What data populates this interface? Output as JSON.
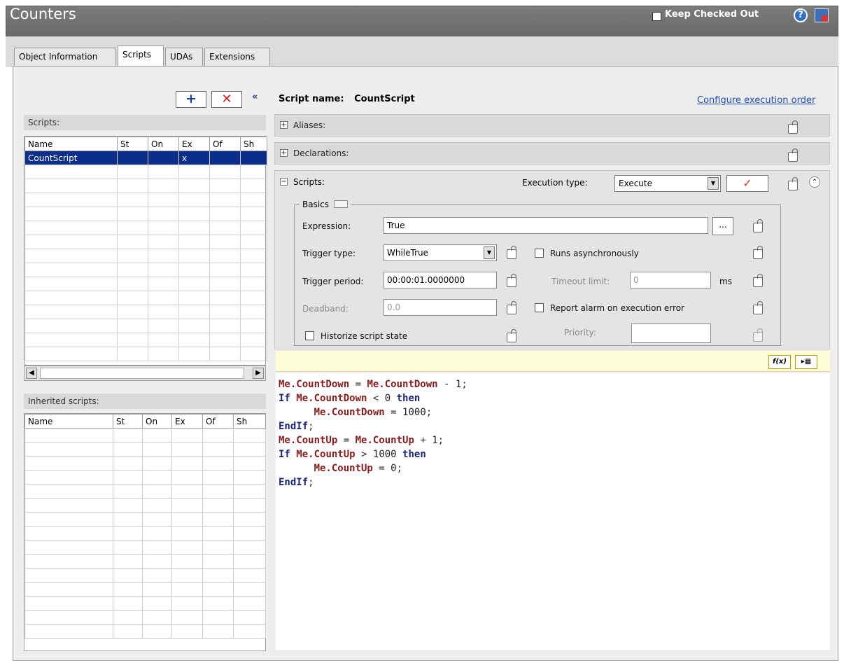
{
  "window": {
    "title": "Counters",
    "keep_checked_out_label": "Keep Checked Out",
    "help_icon": "?"
  },
  "tabs": [
    {
      "label": "Object Information",
      "active": false
    },
    {
      "label": "Scripts",
      "active": true
    },
    {
      "label": "UDAs",
      "active": false
    },
    {
      "label": "Extensions",
      "active": false
    }
  ],
  "left": {
    "add_glyph": "+",
    "delete_glyph": "✕",
    "collapse_glyph": "«",
    "scripts_label": "Scripts:",
    "inherited_label": "Inherited scripts:",
    "columns": [
      "Name",
      "St",
      "On",
      "Ex",
      "Of",
      "Sh"
    ],
    "scripts_rows": [
      {
        "name": "CountScript",
        "st": "",
        "on": "",
        "ex": "x",
        "of": "",
        "sh": "",
        "selected": true
      }
    ]
  },
  "right": {
    "script_name_label": "Script name:",
    "script_name": "CountScript",
    "configure_link": "Configure execution order",
    "sections": {
      "aliases": "Aliases:",
      "declarations": "Declarations:",
      "scripts": "Scripts:"
    },
    "execution_type_label": "Execution type:",
    "execution_type_value": "Execute",
    "basics_label": "Basics",
    "expression_label": "Expression:",
    "expression_value": "True",
    "ellipsis": "...",
    "trigger_type_label": "Trigger type:",
    "trigger_type_value": "WhileTrue",
    "runs_async_label": "Runs asynchronously",
    "trigger_period_label": "Trigger period:",
    "trigger_period_value": "00:00:01.0000000",
    "timeout_label": "Timeout limit:",
    "timeout_value": "0",
    "ms_label": "ms",
    "deadband_label": "Deadband:",
    "deadband_value": "0.0",
    "report_alarm_label": "Report alarm on execution error",
    "historize_label": "Historize script state",
    "priority_label": "Priority:",
    "priority_value": "",
    "fx_label": "f(x)",
    "list_glyph": "▸▦"
  },
  "code": [
    [
      {
        "t": "obj",
        "v": "Me.CountDown"
      },
      {
        "t": "op",
        "v": " = "
      },
      {
        "t": "obj",
        "v": "Me.CountDown"
      },
      {
        "t": "op",
        "v": " - "
      },
      {
        "t": "num",
        "v": "1"
      },
      {
        "t": "op",
        "v": ";"
      }
    ],
    [
      {
        "t": "kw",
        "v": "If "
      },
      {
        "t": "obj",
        "v": "Me.CountDown"
      },
      {
        "t": "op",
        "v": " < "
      },
      {
        "t": "num",
        "v": "0"
      },
      {
        "t": "kw",
        "v": " then"
      }
    ],
    [
      {
        "t": "op",
        "v": "      "
      },
      {
        "t": "obj",
        "v": "Me.CountDown"
      },
      {
        "t": "op",
        "v": " = "
      },
      {
        "t": "num",
        "v": "1000"
      },
      {
        "t": "op",
        "v": ";"
      }
    ],
    [
      {
        "t": "kw",
        "v": "EndIf"
      },
      {
        "t": "op",
        "v": ";"
      }
    ],
    [
      {
        "t": "obj",
        "v": "Me.CountUp"
      },
      {
        "t": "op",
        "v": " = "
      },
      {
        "t": "obj",
        "v": "Me.CountUp"
      },
      {
        "t": "op",
        "v": " + "
      },
      {
        "t": "num",
        "v": "1"
      },
      {
        "t": "op",
        "v": ";"
      }
    ],
    [
      {
        "t": "kw",
        "v": "If "
      },
      {
        "t": "obj",
        "v": "Me.CountUp"
      },
      {
        "t": "op",
        "v": " > "
      },
      {
        "t": "num",
        "v": "1000"
      },
      {
        "t": "kw",
        "v": " then"
      }
    ],
    [
      {
        "t": "op",
        "v": "      "
      },
      {
        "t": "obj",
        "v": "Me.CountUp"
      },
      {
        "t": "op",
        "v": " = "
      },
      {
        "t": "num",
        "v": "0"
      },
      {
        "t": "op",
        "v": ";"
      }
    ],
    [
      {
        "t": "kw",
        "v": "EndIf"
      },
      {
        "t": "op",
        "v": ";"
      }
    ]
  ]
}
